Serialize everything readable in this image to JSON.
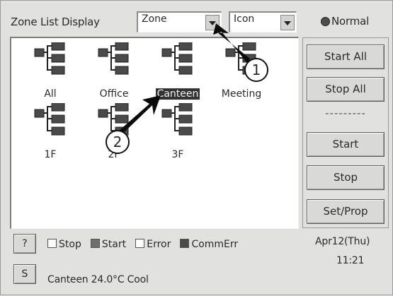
{
  "header": {
    "zone_list_label": "Zone List Display",
    "zone_select_value": "Zone",
    "view_select_value": "Icon",
    "status_text": "Normal"
  },
  "zones": [
    {
      "label": "All",
      "selected": false
    },
    {
      "label": "Office",
      "selected": false
    },
    {
      "label": "Canteen",
      "selected": true
    },
    {
      "label": "Meeting",
      "selected": false
    },
    {
      "label": "1F",
      "selected": false
    },
    {
      "label": "2F",
      "selected": false
    },
    {
      "label": "3F",
      "selected": false
    }
  ],
  "side_buttons": {
    "start_all": "Start All",
    "stop_all": "Stop All",
    "separator": "---------",
    "start": "Start",
    "stop": "Stop",
    "set_prop": "Set/Prop"
  },
  "legend": {
    "help_button": "?",
    "stop": "Stop",
    "start": "Start",
    "error": "Error",
    "comm_err": "CommErr"
  },
  "footer": {
    "s_button": "S",
    "status_line": "Canteen 24.0°C Cool",
    "date": "Apr12(Thu)",
    "time": "11:21"
  },
  "callouts": [
    "1",
    "2"
  ],
  "colors": {
    "panel": "#e1e1df",
    "icon_fill": "#4a4a4a",
    "selected_bg": "#333333"
  },
  "icons": {
    "zone_icon": "tree-hierarchy-icon",
    "status_dot": "status-dot-icon"
  }
}
